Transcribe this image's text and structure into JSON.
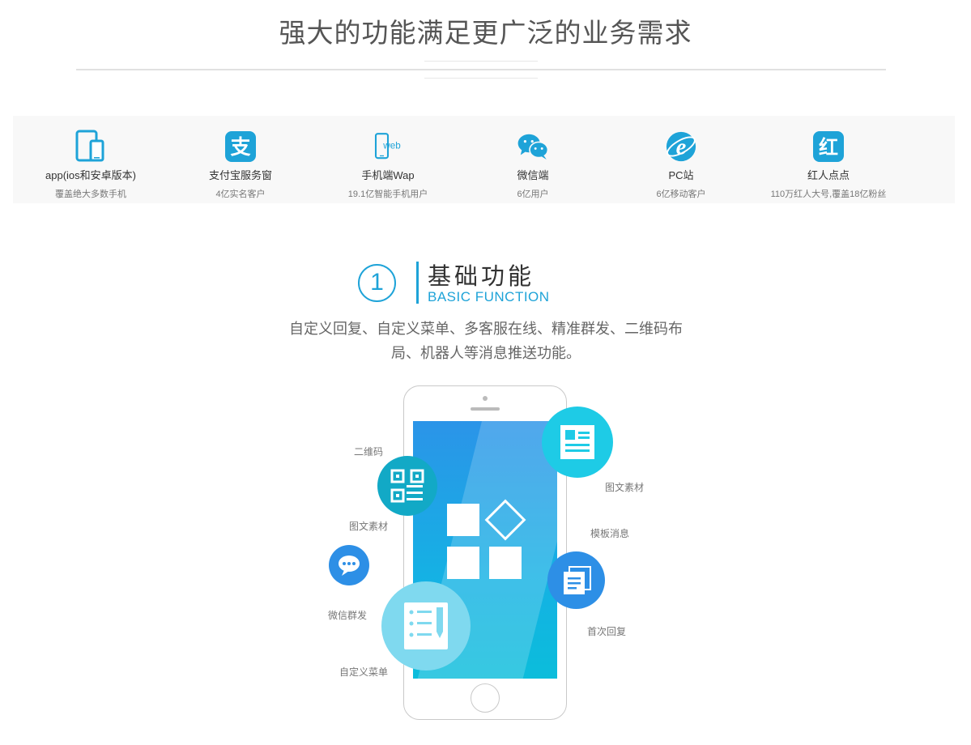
{
  "header": {
    "title": "强大的功能满足更广泛的业务需求"
  },
  "platforms": [
    {
      "icon": "tablet-phone-icon",
      "name": "app(ios和安卓版本)",
      "desc": "覆盖绝大多数手机"
    },
    {
      "icon": "alipay-icon",
      "name": "支付宝服务窗",
      "desc": "4亿实名客户",
      "icon_text": "支"
    },
    {
      "icon": "mobile-web-icon",
      "name": "手机端Wap",
      "desc": "19.1亿智能手机用户",
      "icon_text": "web"
    },
    {
      "icon": "wechat-icon",
      "name": "微信端",
      "desc": "6亿用户"
    },
    {
      "icon": "ie-browser-icon",
      "name": "PC站",
      "desc": "6亿移动客户",
      "icon_text": "e"
    },
    {
      "icon": "hongren-icon",
      "name": "红人点点",
      "desc": "110万红人大号,覆盖18亿粉丝",
      "icon_text": "红"
    }
  ],
  "section": {
    "number": "1",
    "title_cn": "基础功能",
    "title_en": "BASIC FUNCTION",
    "description": "自定义回复、自定义菜单、多客服在线、精准群发、二维码布局、机器人等消息推送功能。"
  },
  "features": {
    "qr_label": "二维码",
    "article_left_label": "图文素材",
    "mass_label": "微信群发",
    "menu_label": "自定义菜单",
    "article_right_label": "图文素材",
    "template_label": "模板消息",
    "first_reply_label": "首次回复"
  },
  "colors": {
    "accent": "#1ea3d8",
    "teal": "#12a9c6",
    "cyan": "#1ecbe6",
    "blue": "#2d8fe6",
    "light_cyan": "#7fd9ef"
  }
}
